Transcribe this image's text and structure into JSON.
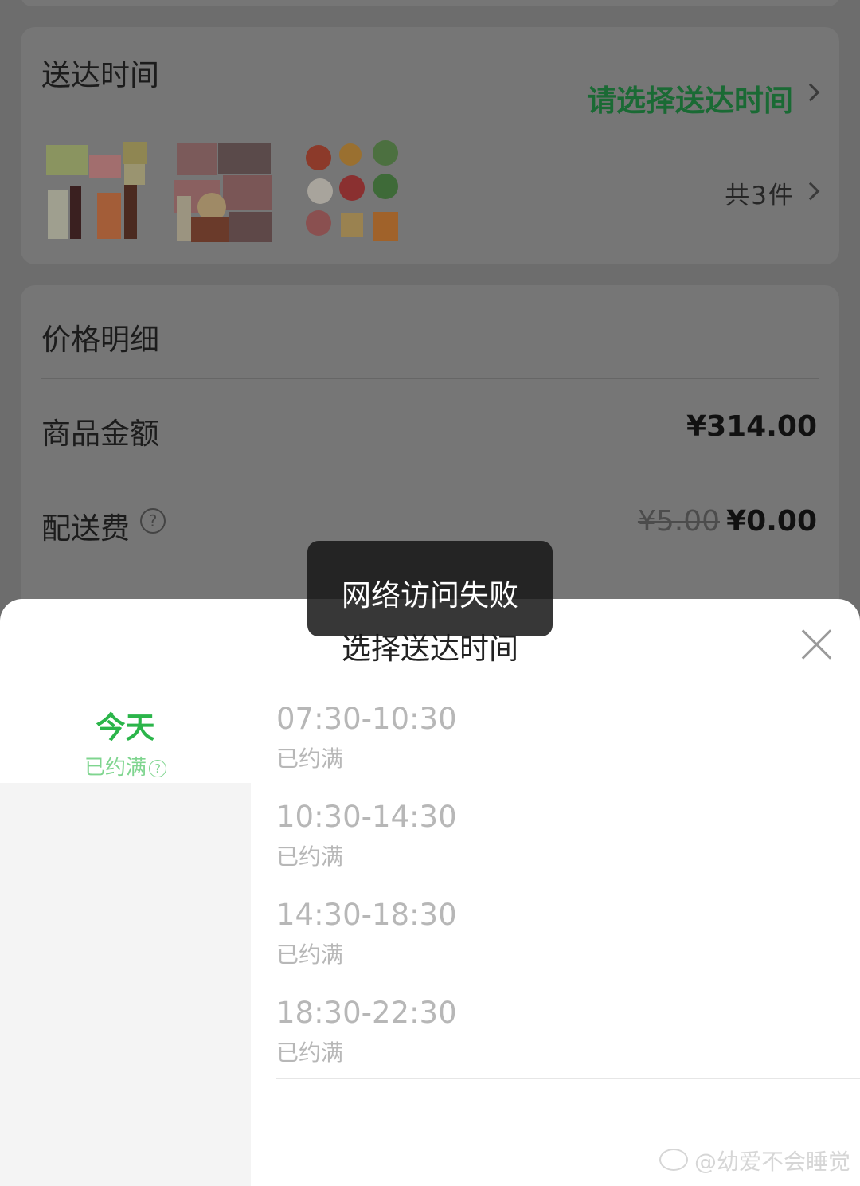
{
  "background": {
    "delivery_time_label": "送达时间",
    "delivery_time_action": "请选择送达时间",
    "products": [
      {
        "icon": "grocery-pack-image"
      },
      {
        "icon": "meat-pack-image"
      },
      {
        "icon": "vegetable-pack-image"
      }
    ],
    "item_count": "共3件",
    "price_detail_title": "价格明细",
    "goods_amount_label": "商品金额",
    "goods_amount_value": "¥314.00",
    "delivery_fee_label": "配送费",
    "delivery_fee_original": "¥5.00",
    "delivery_fee_value": "¥0.00"
  },
  "sheet": {
    "title": "选择送达时间",
    "days": [
      {
        "label": "今天",
        "status": "已约满"
      }
    ],
    "slots": [
      {
        "time": "07:30-10:30",
        "status": "已约满"
      },
      {
        "time": "10:30-14:30",
        "status": "已约满"
      },
      {
        "time": "14:30-18:30",
        "status": "已约满"
      },
      {
        "time": "18:30-22:30",
        "status": "已约满"
      }
    ]
  },
  "toast": {
    "message": "网络访问失败"
  },
  "watermark": "@幼爱不会睡觉",
  "colors": {
    "accent_green": "#2bb54a",
    "dark_green": "#1a6a34"
  }
}
